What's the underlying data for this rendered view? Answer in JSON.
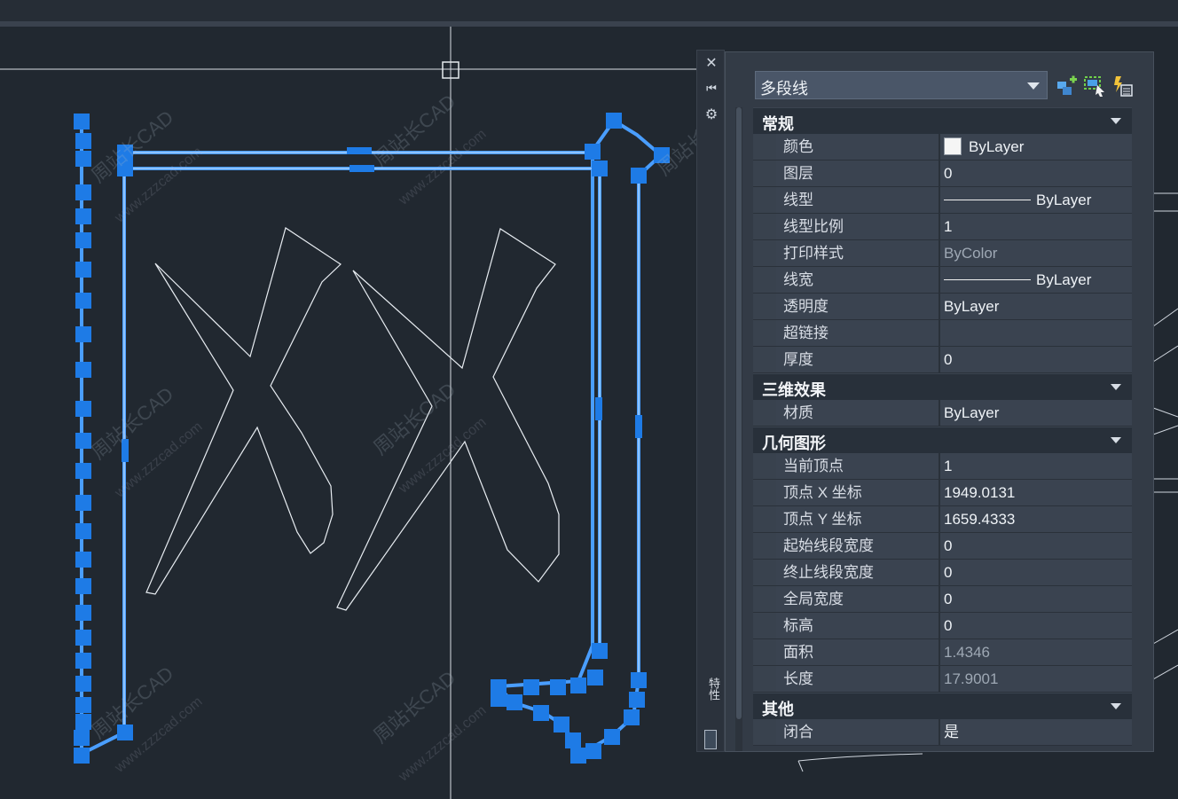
{
  "canvas": {
    "drawing_label": "drawing-canvas",
    "watermarks": [
      "周站长CAD",
      "www.zzzcad.com"
    ]
  },
  "palette": {
    "side_buttons": {
      "close": "✕",
      "autohide": "⏮",
      "settings": "⚙"
    },
    "side_title": "特性",
    "selector": {
      "value": "多段线"
    },
    "tool_icons": [
      "quick-select-icon",
      "select-objects-icon",
      "toggle-pickadd-icon"
    ],
    "sections": [
      {
        "title": "常规",
        "rows": [
          {
            "label": "颜色",
            "value": "ByLayer",
            "kind": "color",
            "swatch": "#f5f5f5"
          },
          {
            "label": "图层",
            "value": "0"
          },
          {
            "label": "线型",
            "value": "ByLayer",
            "kind": "linetype"
          },
          {
            "label": "线型比例",
            "value": "1"
          },
          {
            "label": "打印样式",
            "value": "ByColor",
            "readonly": true
          },
          {
            "label": "线宽",
            "value": "ByLayer",
            "kind": "linetype"
          },
          {
            "label": "透明度",
            "value": "ByLayer"
          },
          {
            "label": "超链接",
            "value": ""
          },
          {
            "label": "厚度",
            "value": "0"
          }
        ]
      },
      {
        "title": "三维效果",
        "rows": [
          {
            "label": "材质",
            "value": "ByLayer"
          }
        ]
      },
      {
        "title": "几何图形",
        "rows": [
          {
            "label": "当前顶点",
            "value": "1"
          },
          {
            "label": "顶点 X 坐标",
            "value": "1949.0131"
          },
          {
            "label": "顶点 Y 坐标",
            "value": "1659.4333"
          },
          {
            "label": "起始线段宽度",
            "value": "0"
          },
          {
            "label": "终止线段宽度",
            "value": "0"
          },
          {
            "label": "全局宽度",
            "value": "0"
          },
          {
            "label": "标高",
            "value": "0"
          },
          {
            "label": "面积",
            "value": "1.4346",
            "readonly": true
          },
          {
            "label": "长度",
            "value": "17.9001",
            "readonly": true
          }
        ]
      },
      {
        "title": "其他",
        "rows": [
          {
            "label": "闭合",
            "value": "是"
          }
        ]
      }
    ]
  },
  "colors": {
    "background": "#212830",
    "grip": "#1e7be6",
    "selection_line": "#4a9eff",
    "geometry": "#e8edf2"
  }
}
